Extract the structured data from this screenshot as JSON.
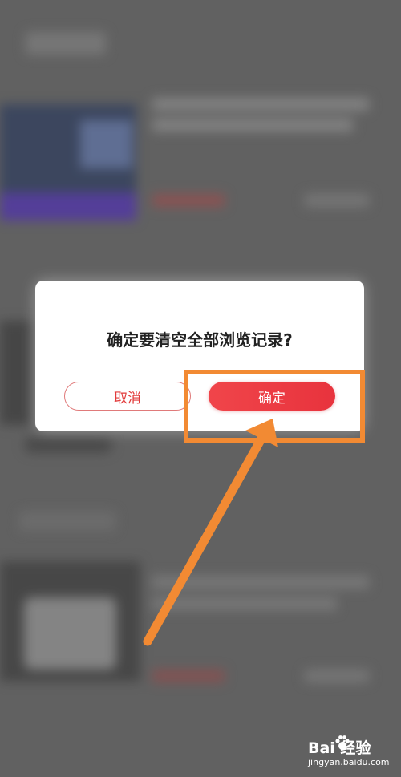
{
  "dialog": {
    "title": "确定要清空全部浏览记录?",
    "cancel_label": "取消",
    "confirm_label": "确定"
  },
  "watermark": {
    "brand": "Bai 经验",
    "url": "jingyan.baidu.com"
  },
  "colors": {
    "accent": "#e8333d",
    "annotation": "#f28a33"
  }
}
